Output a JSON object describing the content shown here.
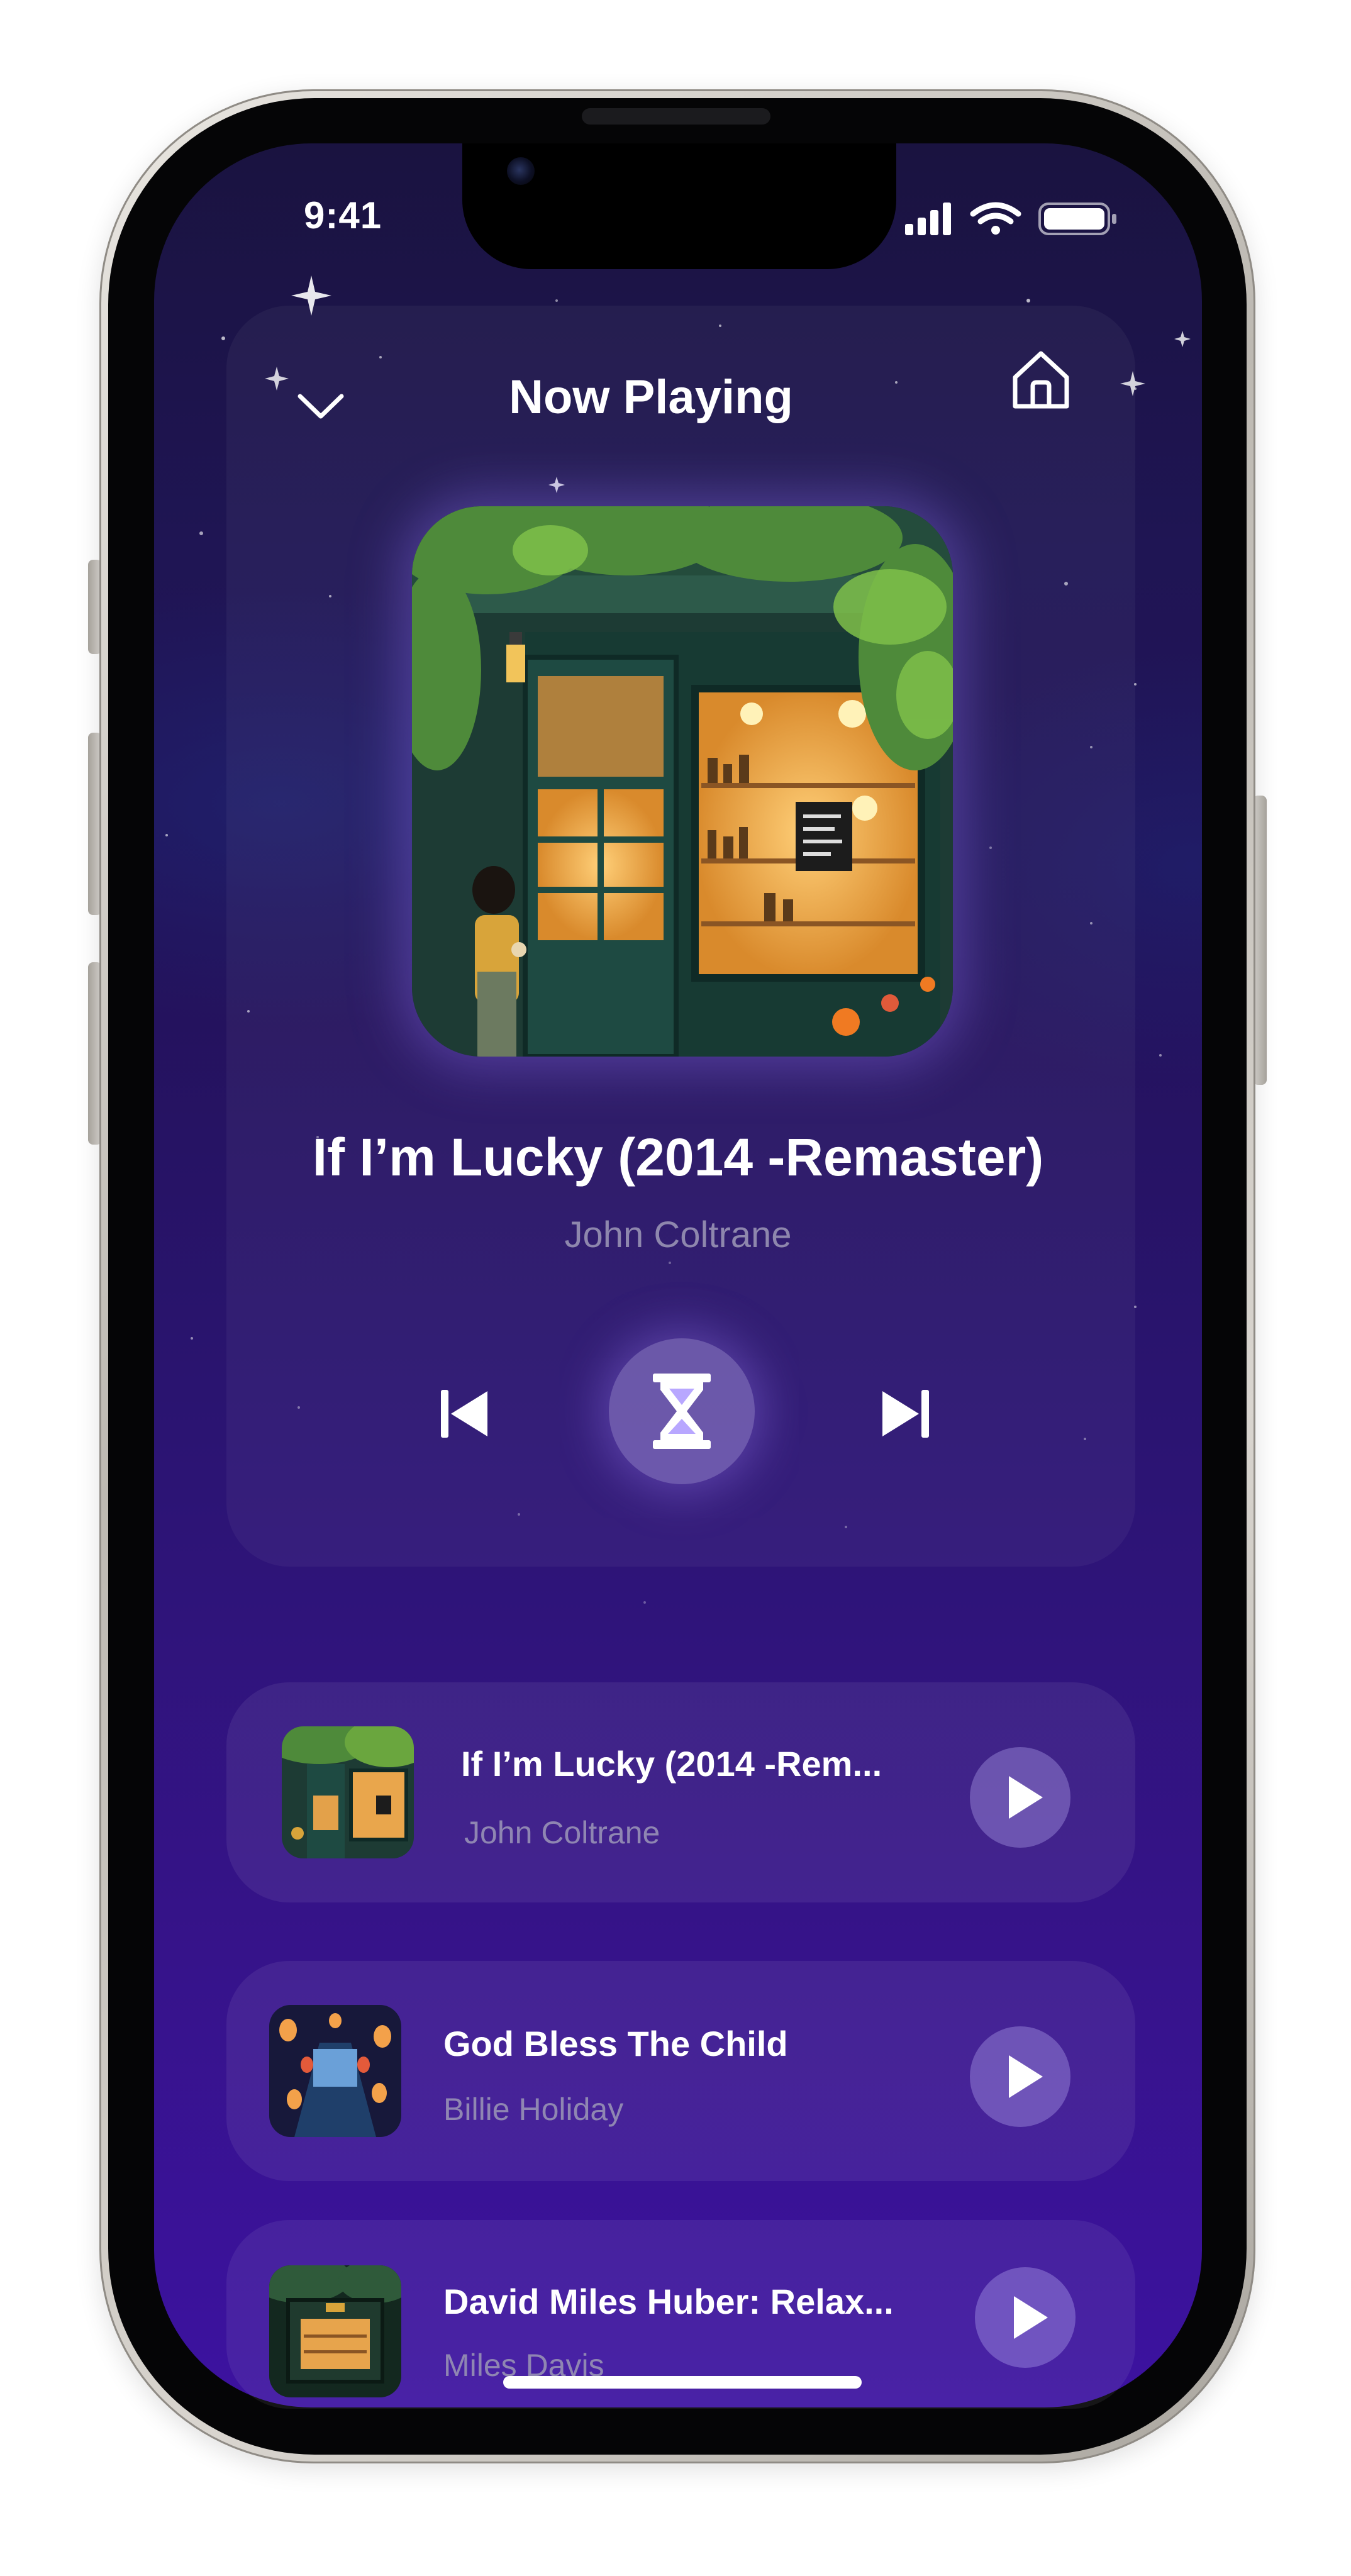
{
  "status_bar": {
    "time": "9:41",
    "icons": [
      "cellular-signal-icon",
      "wifi-icon",
      "battery-icon"
    ]
  },
  "header": {
    "title": "Now Playing",
    "left_icon": "chevron-down-icon",
    "right_icon": "home-icon"
  },
  "now_playing": {
    "title": "If I’m Lucky (2014 -Remaster)",
    "artist": "John Coltrane",
    "artwork": "cafe-storefront-illustration",
    "controls": {
      "previous_icon": "skip-previous-icon",
      "center_icon": "hourglass-icon",
      "next_icon": "skip-next-icon"
    }
  },
  "queue": [
    {
      "title": "If I’m Lucky (2014 -Rem...",
      "artist": "John Coltrane",
      "thumb": "cafe-storefront-thumbnail",
      "action_icon": "play-icon"
    },
    {
      "title": "God Bless The Child",
      "artist": "Billie Holiday",
      "thumb": "lantern-street-thumbnail",
      "action_icon": "play-icon"
    },
    {
      "title": "David Miles Huber: Relax...",
      "artist": "Miles Davis",
      "thumb": "night-shop-thumbnail",
      "action_icon": "play-icon"
    }
  ],
  "colors": {
    "background_top": "#1a1340",
    "background_bottom": "#3c12a0",
    "accent": "#c8b9ff",
    "text_primary": "#ffffff",
    "text_secondary": "#8e87ad"
  }
}
